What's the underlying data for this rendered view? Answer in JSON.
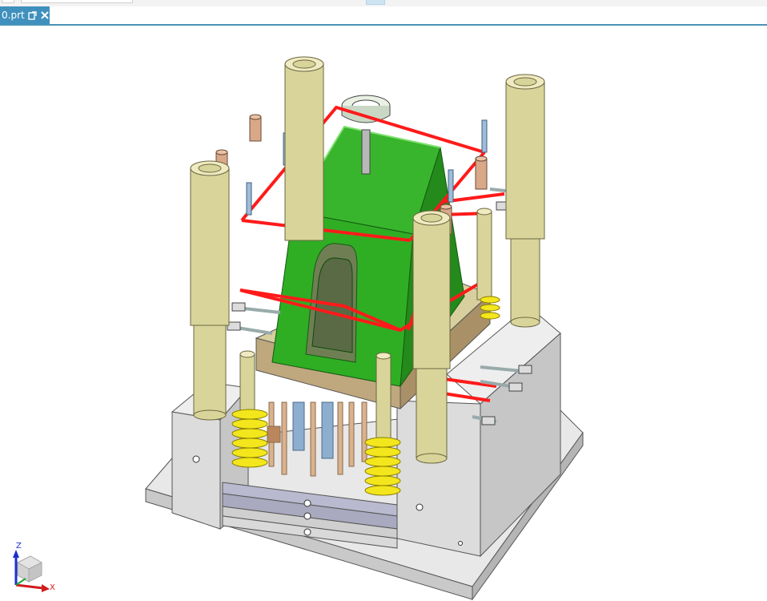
{
  "tab": {
    "label": "0.prt"
  },
  "axis": {
    "z": "Z",
    "x": "X"
  },
  "colors": {
    "tab_bg": "#3f90bd",
    "cavity_green": "#2fae24",
    "guide_red": "#ff1a1a",
    "pillar_tan": "#d9d59a",
    "spring_yellow": "#f3e61c",
    "plate_gray": "#dcdcdc"
  }
}
